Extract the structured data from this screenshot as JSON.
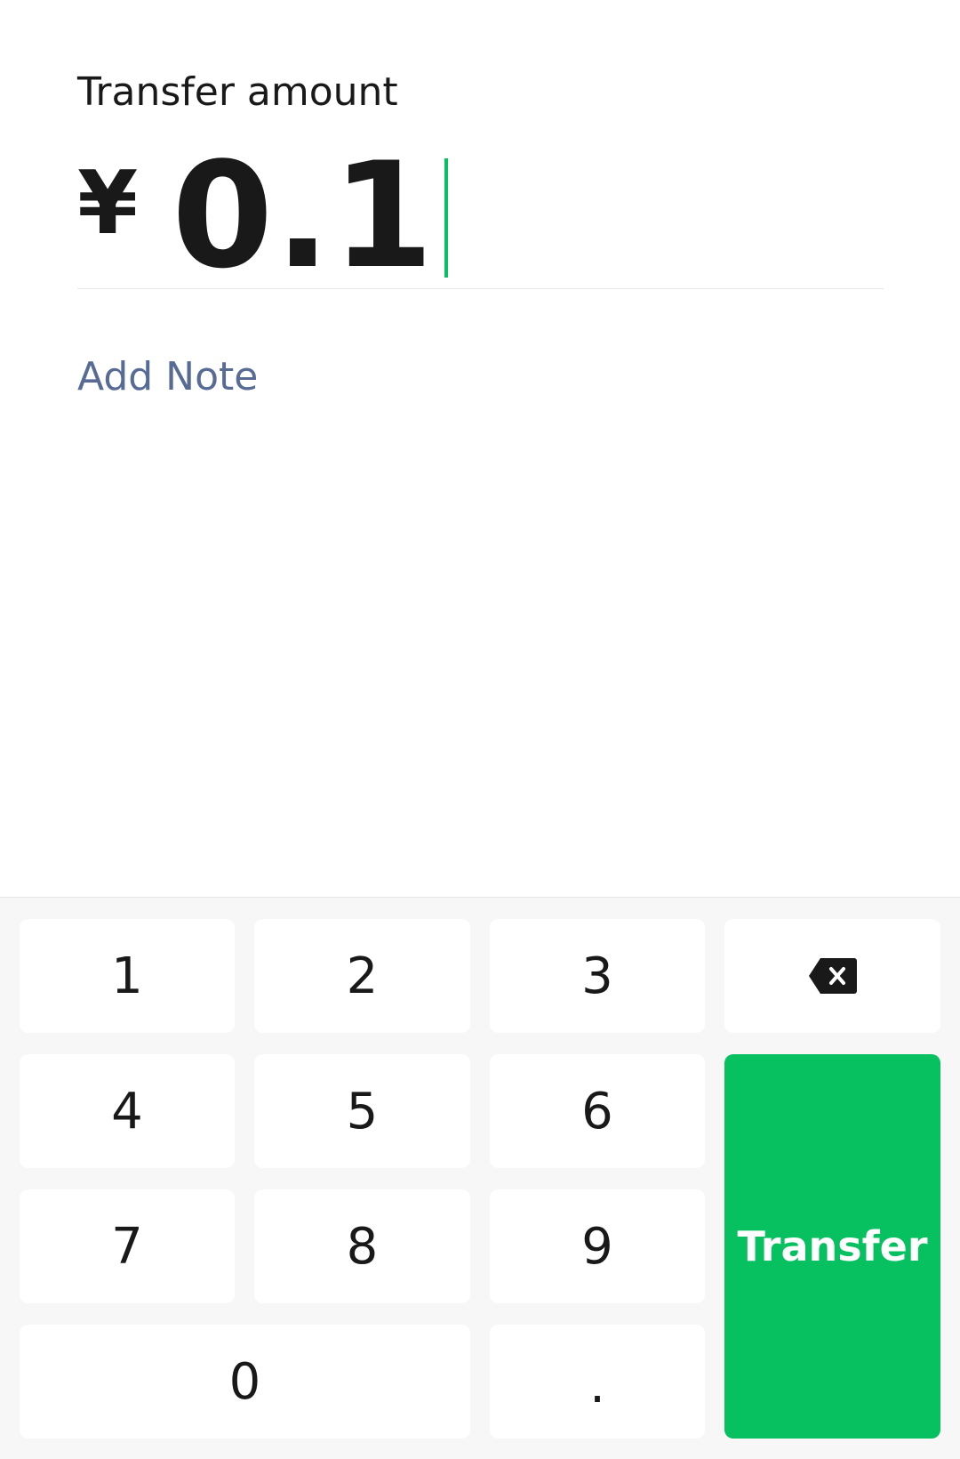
{
  "amount_panel": {
    "title": "Transfer amount",
    "currency_symbol": "¥",
    "amount": "0.1",
    "add_note_label": "Add Note"
  },
  "keypad": {
    "keys": [
      "1",
      "2",
      "3",
      "4",
      "5",
      "6",
      "7",
      "8",
      "9",
      "0",
      "."
    ],
    "backspace_icon": "backspace-icon",
    "transfer_label": "Transfer"
  },
  "colors": {
    "accent": "#07c160",
    "link": "#576b95",
    "text": "#191919",
    "keypad_background": "#f7f7f7"
  }
}
